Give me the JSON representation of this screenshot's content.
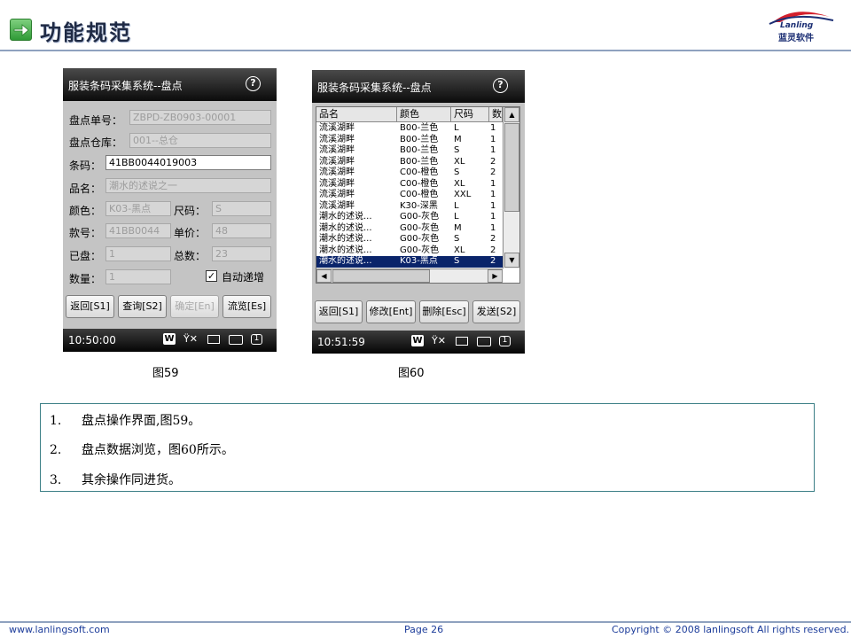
{
  "header": {
    "title": "功能规范",
    "logo_text": "Lanling",
    "logo_cn": "蓝灵软件"
  },
  "fig59": {
    "title": "服装条码采集系统--盘点",
    "help": "?",
    "labels": {
      "doc_no": "盘点单号：",
      "warehouse": "盘点仓库：",
      "barcode": "条码：",
      "name": "品名：",
      "color": "颜色：",
      "size": "尺码：",
      "style": "款号：",
      "price": "单价：",
      "counted": "已盘：",
      "total": "总数：",
      "qty": "数量："
    },
    "values": {
      "doc_no": "ZBPD-ZB0903-00001",
      "warehouse": "001--总仓",
      "barcode": "41BB0044019003",
      "name": "潮水的述说之一",
      "color": "K03-黑点",
      "size": "S",
      "style": "41BB0044",
      "price": "48",
      "counted": "1",
      "total": "23",
      "qty": "1"
    },
    "auto_increment": "自动递增",
    "buttons": {
      "back": "返回[S1]",
      "query": "查询[S2]",
      "confirm": "确定[En]",
      "browse": "流览[Es]"
    },
    "clock": "10:50:00",
    "caption": "图59"
  },
  "fig60": {
    "title": "服装条码采集系统--盘点",
    "help": "?",
    "columns": [
      "品名",
      "颜色",
      "尺码",
      "数"
    ],
    "rows": [
      [
        "流溪湖畔",
        "B00-兰色",
        "L",
        "1"
      ],
      [
        "流溪湖畔",
        "B00-兰色",
        "M",
        "1"
      ],
      [
        "流溪湖畔",
        "B00-兰色",
        "S",
        "1"
      ],
      [
        "流溪湖畔",
        "B00-兰色",
        "XL",
        "2"
      ],
      [
        "流溪湖畔",
        "C00-橙色",
        "S",
        "2"
      ],
      [
        "流溪湖畔",
        "C00-橙色",
        "XL",
        "1"
      ],
      [
        "流溪湖畔",
        "C00-橙色",
        "XXL",
        "1"
      ],
      [
        "流溪湖畔",
        "K30-深黑",
        "L",
        "1"
      ],
      [
        "潮水的述说...",
        "G00-灰色",
        "L",
        "1"
      ],
      [
        "潮水的述说...",
        "G00-灰色",
        "M",
        "1"
      ],
      [
        "潮水的述说...",
        "G00-灰色",
        "S",
        "2"
      ],
      [
        "潮水的述说...",
        "G00-灰色",
        "XL",
        "2"
      ],
      [
        "潮水的述说...",
        "K03-黑点",
        "S",
        "2"
      ]
    ],
    "buttons": {
      "back": "返回[S1]",
      "edit": "修改[Ent]",
      "delete": "删除[Esc]",
      "send": "发送[S2]"
    },
    "clock": "10:51:59",
    "caption": "图60"
  },
  "notes": [
    {
      "n": "1.",
      "text": "盘点操作界面,图59。"
    },
    {
      "n": "2.",
      "text": "盘点数据浏览，图60所示。"
    },
    {
      "n": "3.",
      "text": "其余操作同进货。"
    }
  ],
  "footer": {
    "url": "www.lanlingsoft.com",
    "page": "Page 26",
    "copyright": "Copyright © 2008 lanlingsoft All rights reserved."
  },
  "colors": {
    "accent": "#1c2f74",
    "selected_row": "#0a246a",
    "border": "#3b7f86"
  }
}
